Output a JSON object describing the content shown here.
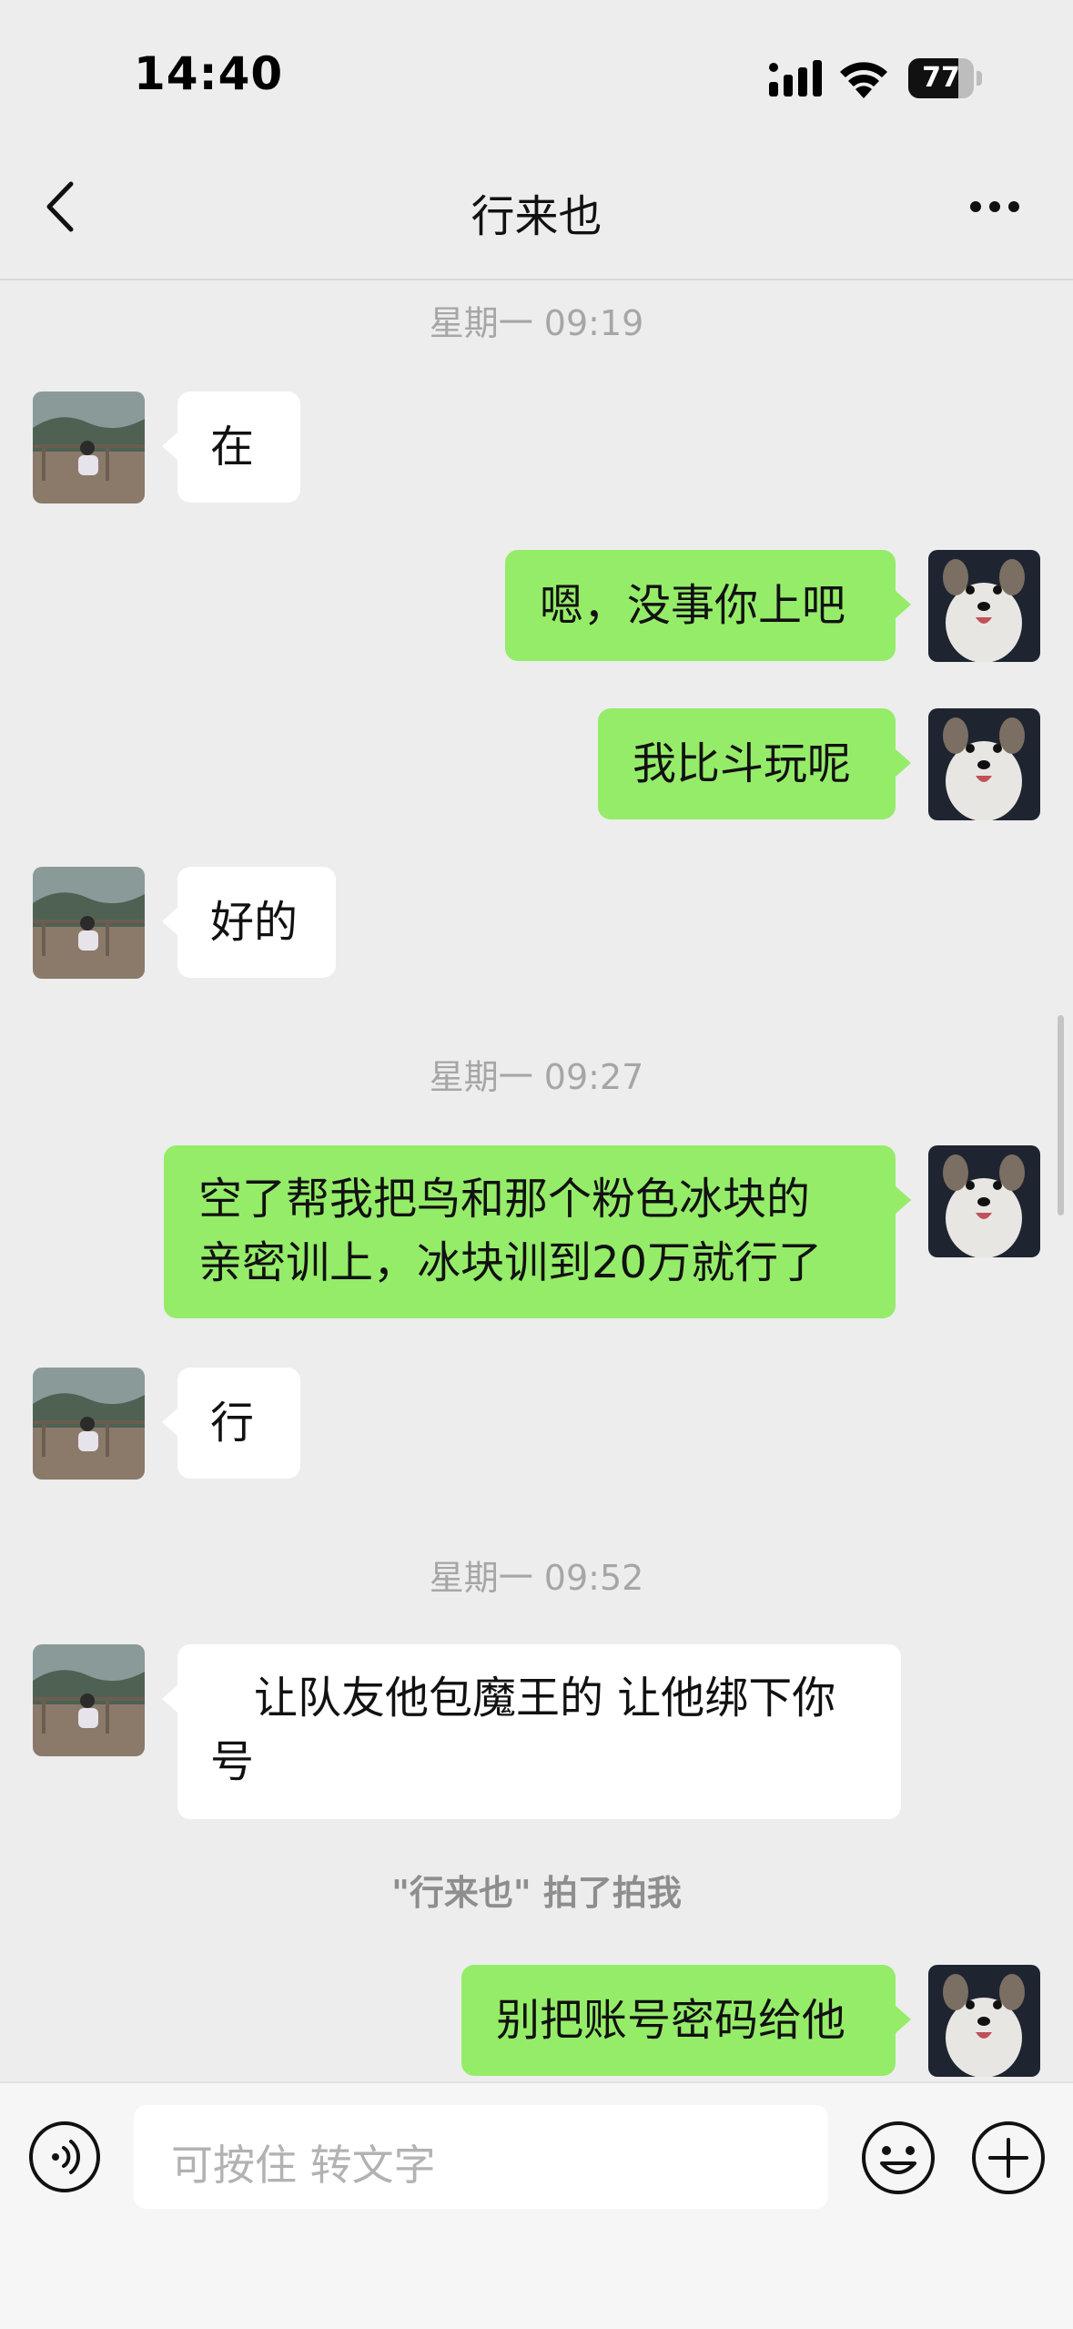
{
  "status_bar": {
    "time": "14:40",
    "battery_level": "77",
    "battery_fraction": 0.77
  },
  "nav": {
    "title": "行来也",
    "back_icon": "chevron-left-icon",
    "more_icon": "more-horizontal-icon"
  },
  "timestamps": [
    "星期一 09:19",
    "星期一 09:27",
    "星期一 09:52"
  ],
  "messages": [
    {
      "side": "in",
      "text": "在"
    },
    {
      "side": "out",
      "text": "嗯，没事你上吧"
    },
    {
      "side": "out",
      "text": "我比斗玩呢"
    },
    {
      "side": "in",
      "text": "好的"
    },
    {
      "side": "out",
      "lines": [
        "空了帮我把鸟和那个粉色冰块的",
        "亲密训上，冰块训到20万就行了"
      ]
    },
    {
      "side": "in",
      "text": "行"
    },
    {
      "side": "in",
      "lines": [
        "　让队友他包魔王的 让他绑下你",
        "号"
      ]
    },
    {
      "side": "out",
      "text": "别把账号密码给他"
    }
  ],
  "system_message": "\"行来也\" 拍了拍我",
  "input_bar": {
    "placeholder": "可按住 转文字",
    "voice_icon": "voice-icon",
    "emoji_icon": "emoji-icon",
    "plus_icon": "plus-circle-icon"
  },
  "colors": {
    "background": "#ededed",
    "outgoing_bubble": "#95ec69",
    "incoming_bubble": "#ffffff",
    "timestamp": "#a6a6a6"
  }
}
